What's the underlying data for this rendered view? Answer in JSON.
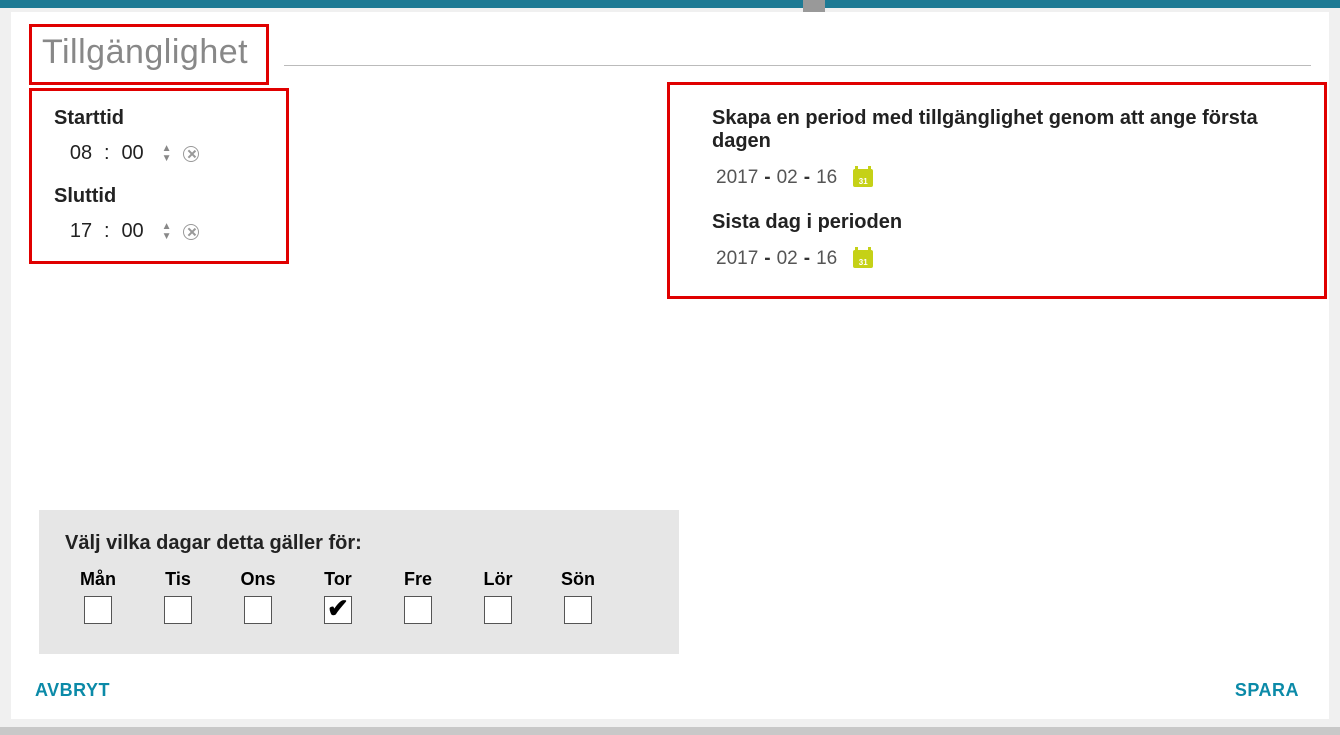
{
  "title": "Tillgänglighet",
  "start": {
    "label": "Starttid",
    "hh": "08",
    "mm": "00"
  },
  "end": {
    "label": "Sluttid",
    "hh": "17",
    "mm": "00"
  },
  "period": {
    "from_label": "Skapa en period med tillgänglighet genom att ange första dagen",
    "to_label": "Sista dag i perioden",
    "from": {
      "y": "2017",
      "m": "02",
      "d": "16"
    },
    "to": {
      "y": "2017",
      "m": "02",
      "d": "16"
    },
    "cal_day": "31"
  },
  "days": {
    "label": "Välj vilka dagar detta gäller för:",
    "items": [
      {
        "name": "Mån",
        "checked": false
      },
      {
        "name": "Tis",
        "checked": false
      },
      {
        "name": "Ons",
        "checked": false
      },
      {
        "name": "Tor",
        "checked": true
      },
      {
        "name": "Fre",
        "checked": false
      },
      {
        "name": "Lör",
        "checked": false
      },
      {
        "name": "Sön",
        "checked": false
      }
    ]
  },
  "actions": {
    "cancel": "AVBRYT",
    "save": "SPARA"
  }
}
